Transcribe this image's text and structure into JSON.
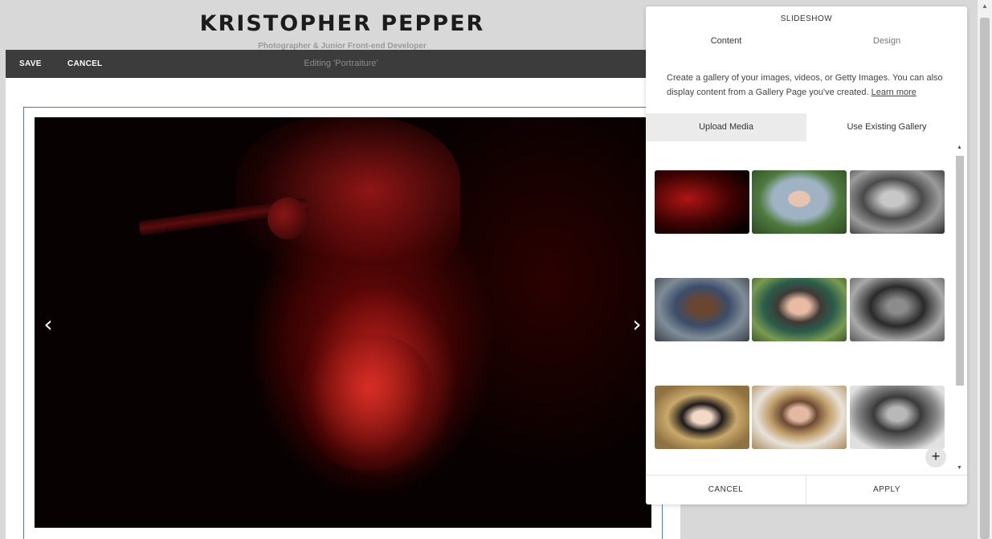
{
  "site": {
    "title": "KRISTOPHER PEPPER",
    "subtitle": "Photographer & Junior Front-end Developer"
  },
  "edit_bar": {
    "save_label": "SAVE",
    "cancel_label": "CANCEL",
    "editing_text": "Editing 'Portraiture'"
  },
  "slideshow": {
    "prev_arrow": "‹",
    "next_arrow": "›"
  },
  "panel": {
    "title": "SLIDESHOW",
    "tabs": [
      {
        "label": "Content"
      },
      {
        "label": "Design"
      }
    ],
    "description": "Create a gallery of your images, videos, or Getty Images. You can also display content from a Gallery Page you've created. ",
    "learn_more": "Learn more",
    "segments": [
      {
        "label": "Upload Media"
      },
      {
        "label": "Use Existing Gallery"
      }
    ],
    "add_symbol": "+",
    "cancel_label": "CANCEL",
    "apply_label": "APPLY"
  },
  "scroll": {
    "up": "▲",
    "down": "▼"
  }
}
